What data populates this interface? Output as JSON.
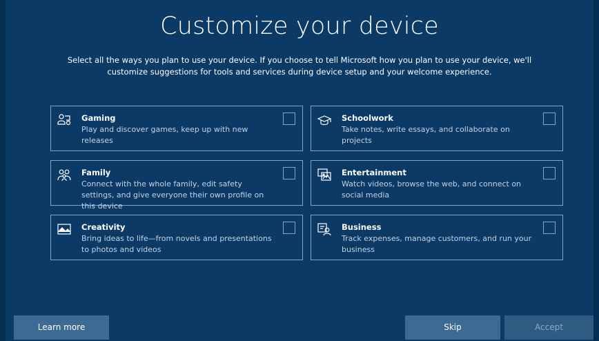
{
  "page": {
    "title": "Customize your device",
    "subtitle": "Select all the ways you plan to use your device. If you choose to tell Microsoft how you plan to use your device, we'll customize suggestions for tools and services during device setup and your welcome experience."
  },
  "options": [
    {
      "title": "Gaming",
      "description": "Play and discover games, keep up with new releases",
      "icon": "gaming-icon",
      "checked": false
    },
    {
      "title": "Schoolwork",
      "description": "Take notes, write essays, and collaborate on projects",
      "icon": "graduation-cap-icon",
      "checked": false
    },
    {
      "title": "Family",
      "description": "Connect with the whole family, edit safety settings, and give everyone their own profile on this device",
      "icon": "family-icon",
      "checked": false
    },
    {
      "title": "Entertainment",
      "description": "Watch videos, browse the web, and connect on social media",
      "icon": "entertainment-icon",
      "checked": false
    },
    {
      "title": "Creativity",
      "description": "Bring ideas to life—from novels and presentations to photos and videos",
      "icon": "picture-icon",
      "checked": false
    },
    {
      "title": "Business",
      "description": "Track expenses, manage customers, and run your business",
      "icon": "business-icon",
      "checked": false
    }
  ],
  "buttons": {
    "learn_more": "Learn more",
    "skip": "Skip",
    "accept": "Accept"
  },
  "colors": {
    "background": "#0b3a66",
    "card_border": "#7ea5cc",
    "button": "#3c6a93",
    "button_disabled": "#2f5b83"
  }
}
